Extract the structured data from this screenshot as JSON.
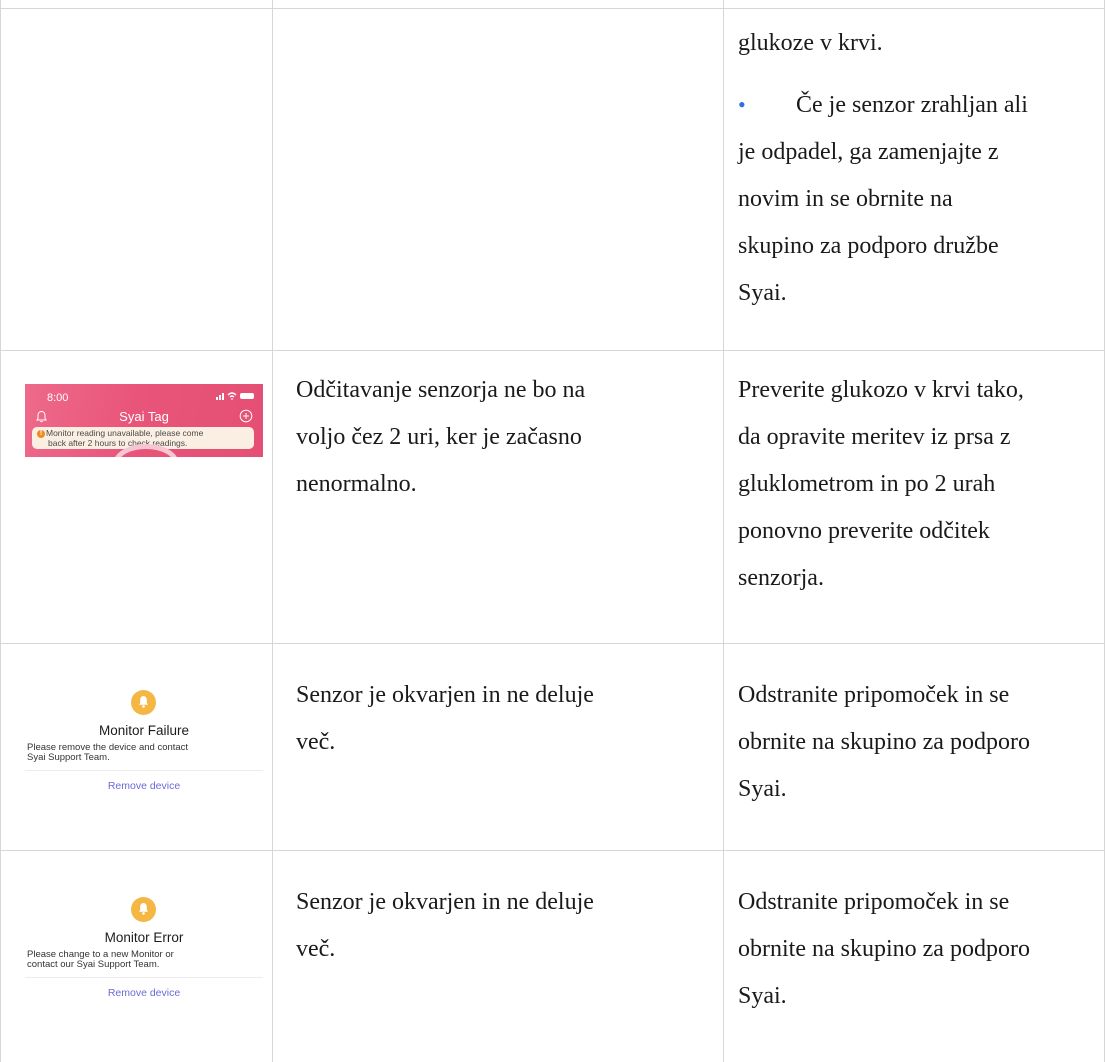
{
  "rows": [
    {
      "description_lines": [],
      "action_lines": [
        "glukoze v krvi."
      ],
      "bullet": {
        "marker": "•",
        "lines": [
          "Če je senzor zrahljan ali",
          "je odpadel, ga zamenjajte z",
          "novim in se obrnite na",
          "skupino za podporo družbe",
          "Syai."
        ]
      }
    },
    {
      "phone": {
        "time": "8:00",
        "app_title": "Syai Tag",
        "banner_lines": [
          "Monitor reading unavailable, please come",
          "back after 2 hours to check readings."
        ]
      },
      "description_lines": [
        "Odčitavanje senzorja ne bo na",
        "voljo čez 2 uri, ker je začasno",
        "nenormalno."
      ],
      "action_lines": [
        "Preverite glukozo v krvi tako,",
        "da opravite meritev iz prsa z",
        "gluklometrom in po 2 urah",
        "ponovno preverite odčitek",
        "senzorja."
      ]
    },
    {
      "alert": {
        "title": "Monitor Failure",
        "desc_lines": [
          "Please remove the device and contact",
          "Syai Support Team."
        ],
        "remove_label": "Remove device"
      },
      "description_lines": [
        "Senzor je okvarjen in ne deluje",
        "več."
      ],
      "action_lines": [
        "Odstranite pripomoček in se",
        "obrnite na skupino za podporo",
        "Syai."
      ]
    },
    {
      "alert": {
        "title": "Monitor Error",
        "desc_lines": [
          "Please change to a new Monitor or",
          "contact our Syai Support Team."
        ],
        "remove_label": "Remove device"
      },
      "description_lines": [
        "Senzor je okvarjen in ne deluje",
        "več."
      ],
      "action_lines": [
        "Odstranite pripomoček in se",
        "obrnite na skupino za podporo",
        "Syai."
      ]
    }
  ],
  "colors": {
    "grid_line": "#d6d6d6",
    "bullet_blue": "#2f6fe0",
    "phone_pink": "#e9557a",
    "alert_yellow": "#f5b743",
    "warning_orange": "#f08a1c",
    "link_purple": "#6a6ad8"
  },
  "icons": {
    "phone_bell": "bell-icon",
    "phone_add": "add-circle-icon",
    "banner_warning": "warning-icon",
    "alert_bell": "bell-icon"
  }
}
